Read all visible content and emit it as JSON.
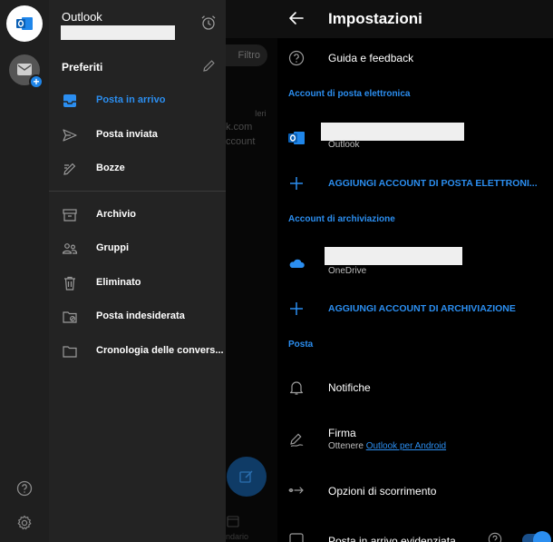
{
  "drawer": {
    "account_name": "Outlook",
    "favorites_label": "Preferiti",
    "folders": [
      {
        "label": "Posta in arrivo",
        "icon": "inbox-icon",
        "active": true
      },
      {
        "label": "Posta inviata",
        "icon": "send-icon"
      },
      {
        "label": "Bozze",
        "icon": "draft-icon"
      },
      {
        "label": "Archivio",
        "icon": "archive-icon"
      },
      {
        "label": "Gruppi",
        "icon": "groups-icon"
      },
      {
        "label": "Eliminato",
        "icon": "trash-icon"
      },
      {
        "label": "Posta indesiderata",
        "icon": "junk-icon"
      },
      {
        "label": "Cronologia delle convers...",
        "icon": "folder-icon"
      }
    ]
  },
  "inbox": {
    "filter_label": "Filtro",
    "message_time": "Ieri",
    "message_line1": "k.com",
    "message_line2": "ccount",
    "calendar_label": "ndario"
  },
  "settings": {
    "title": "Impostazioni",
    "help_label": "Guida e feedback",
    "email_section": "Account di posta elettronica",
    "email_account_type": "Outlook",
    "add_email_account": "AGGIUNGI ACCOUNT DI POSTA ELETTRONI...",
    "storage_section": "Account di archiviazione",
    "storage_account_type": "OneDrive",
    "add_storage_account": "AGGIUNGI ACCOUNT DI ARCHIVIAZIONE",
    "mail_section": "Posta",
    "notifications_label": "Notifiche",
    "signature_label": "Firma",
    "signature_prefix": "Ottenere",
    "signature_link": "Outlook per Android",
    "swipe_label": "Opzioni di scorrimento",
    "focused_inbox_label": "Posta in arrivo evidenziata"
  },
  "colors": {
    "accent": "#2b8ef0",
    "background": "#000000",
    "drawer": "#232323",
    "rail": "#1f1f1f"
  }
}
